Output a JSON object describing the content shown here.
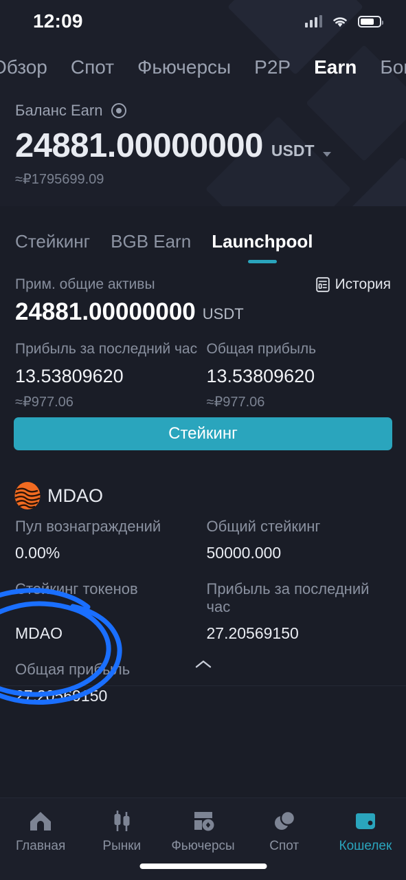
{
  "status_bar": {
    "time": "12:09",
    "signal_icon": "cellular-signal-icon",
    "wifi_icon": "wifi-icon",
    "battery_icon": "battery-icon"
  },
  "top_tabs": [
    {
      "label": "Обзор",
      "active": false
    },
    {
      "label": "Спот",
      "active": false
    },
    {
      "label": "Фьючерсы",
      "active": false
    },
    {
      "label": "P2P",
      "active": false
    },
    {
      "label": "Earn",
      "active": true
    },
    {
      "label": "Бонусы",
      "active": false
    }
  ],
  "balance": {
    "label": "Баланс Earn",
    "eye_icon": "eye-visibility-icon",
    "amount": "24881.00000000",
    "currency": "USDT",
    "currency_caret_icon": "chevron-down-icon",
    "fiat_approx": "≈₽1795699.09"
  },
  "section_tabs": [
    {
      "label": "Стейкинг",
      "active": false
    },
    {
      "label": "BGB Earn",
      "active": false
    },
    {
      "label": "Launchpool",
      "active": true
    }
  ],
  "assets": {
    "label": "Прим. общие активы",
    "history_label": "История",
    "history_icon": "history-list-icon",
    "amount": "24881.00000000",
    "currency": "USDT"
  },
  "profit": {
    "hourly": {
      "label": "Прибыль за последний час",
      "value": "13.53809620",
      "fiat": "≈₽977.06"
    },
    "total": {
      "label": "Общая прибыль",
      "value": "13.53809620",
      "fiat": "≈₽977.06"
    }
  },
  "stake_button": {
    "label": "Стейкинг"
  },
  "pool": {
    "logo_icon": "mdao-token-icon",
    "name": "MDAO",
    "reward_pool": {
      "label": "Пул вознаграждений",
      "value": "0.00%"
    },
    "total_staking": {
      "label": "Общий стейкинг",
      "value": "50000.000"
    },
    "staking_tokens": {
      "label": "Стейкинг токенов",
      "value": "MDAO"
    },
    "hourly_profit": {
      "label": "Прибыль за последний час",
      "value": "27.20569150"
    },
    "total_profit": {
      "label": "Общая прибыль",
      "value": "27.20569150"
    },
    "collapse_icon": "chevron-up-icon"
  },
  "annotation": {
    "shape": "hand-drawn-circle",
    "color": "#1a6fff"
  },
  "bottom_nav": [
    {
      "label": "Главная",
      "icon": "home-icon",
      "active": false
    },
    {
      "label": "Рынки",
      "icon": "candlestick-markets-icon",
      "active": false
    },
    {
      "label": "Фьючерсы",
      "icon": "futures-icon",
      "active": false
    },
    {
      "label": "Спот",
      "icon": "spot-trade-icon",
      "active": false
    },
    {
      "label": "Кошелек",
      "icon": "wallet-icon",
      "active": true
    }
  ],
  "home_indicator": "home-indicator-bar",
  "colors": {
    "background": "#1a1d27",
    "header": "#1c1f2a",
    "accent": "#2aa5bd",
    "token": "#f26b21",
    "annotation": "#1a6fff"
  }
}
